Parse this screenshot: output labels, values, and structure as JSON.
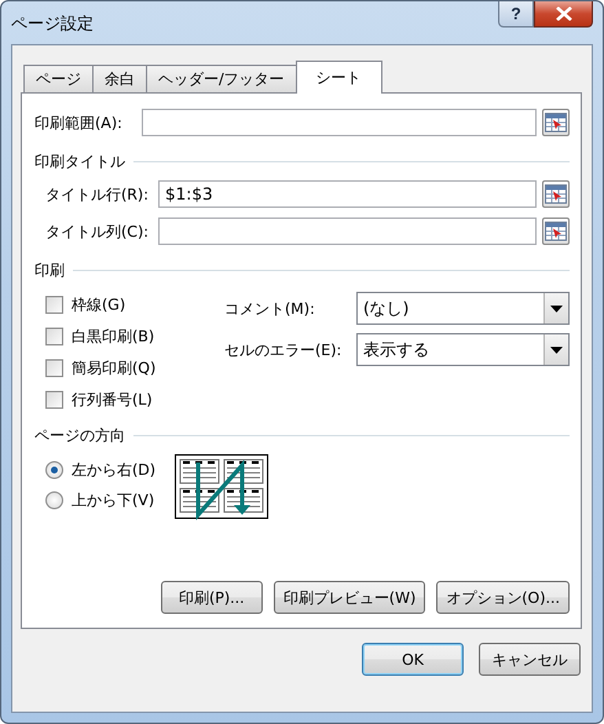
{
  "window": {
    "title": "ページ設定",
    "help": "?"
  },
  "tabs": [
    {
      "label": "ページ",
      "selected": false
    },
    {
      "label": "余白",
      "selected": false
    },
    {
      "label": "ヘッダー/フッター",
      "selected": false
    },
    {
      "label": "シート",
      "selected": true
    }
  ],
  "print_area": {
    "label": "印刷範囲(A):"
  },
  "print_titles": {
    "heading": "印刷タイトル",
    "rows": [
      {
        "label": "タイトル行(R):",
        "value": "$1:$3"
      },
      {
        "label": "タイトル列(C):"
      }
    ]
  },
  "print": {
    "heading": "印刷",
    "checkboxes": [
      {
        "label": "枠線(G)",
        "checked": false
      },
      {
        "label": "白黒印刷(B)",
        "checked": false
      },
      {
        "label": "簡易印刷(Q)",
        "checked": false
      },
      {
        "label": "行列番号(L)",
        "checked": false
      }
    ],
    "dropdowns": [
      {
        "label": "コメント(M):",
        "value": "(なし)"
      },
      {
        "label": "セルのエラー(E):",
        "value": "表示する"
      }
    ]
  },
  "page_order": {
    "heading": "ページの方向",
    "radios": [
      {
        "label": "左から右(D)",
        "selected": true
      },
      {
        "label": "上から下(V)",
        "selected": false
      }
    ]
  },
  "panel_buttons": [
    "印刷(P)...",
    "印刷プレビュー(W)",
    "オプション(O)..."
  ],
  "dialog_buttons": [
    {
      "label": "OK",
      "default": true
    },
    {
      "label": "キャンセル",
      "default": false
    }
  ]
}
